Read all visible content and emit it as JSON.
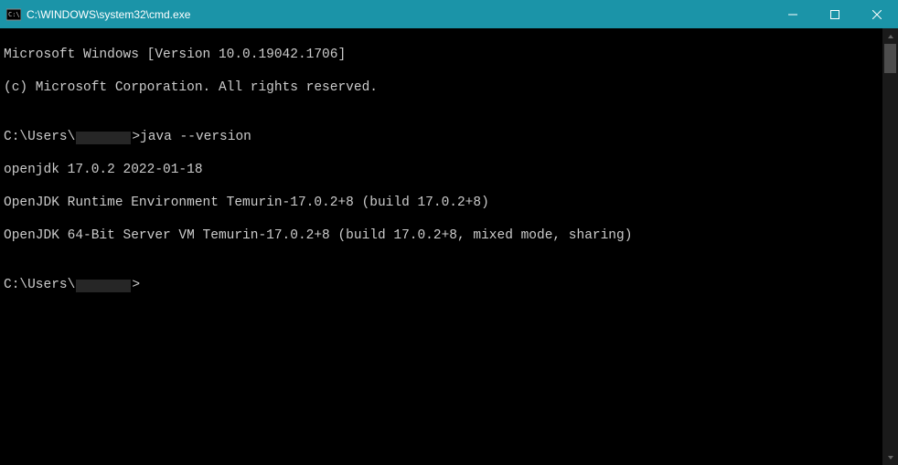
{
  "titlebar": {
    "title": "C:\\WINDOWS\\system32\\cmd.exe"
  },
  "terminal": {
    "line1": "Microsoft Windows [Version 10.0.19042.1706]",
    "line2": "(c) Microsoft Corporation. All rights reserved.",
    "blank": "",
    "prompt1_prefix": "C:\\Users\\",
    "prompt1_suffix": ">java --version",
    "out1": "openjdk 17.0.2 2022-01-18",
    "out2": "OpenJDK Runtime Environment Temurin-17.0.2+8 (build 17.0.2+8)",
    "out3": "OpenJDK 64-Bit Server VM Temurin-17.0.2+8 (build 17.0.2+8, mixed mode, sharing)",
    "prompt2_prefix": "C:\\Users\\",
    "prompt2_suffix": ">"
  }
}
